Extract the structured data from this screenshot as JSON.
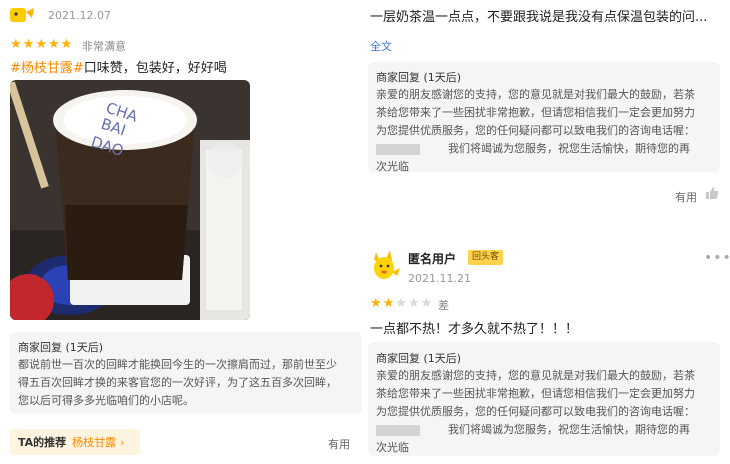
{
  "left": {
    "date": "2021.12.07",
    "rating": {
      "filled": 5,
      "total": 5,
      "label": "非常满意"
    },
    "review": {
      "tag1": "#杨枝甘露#",
      "text": "口味赞，包装好，好好喝"
    },
    "photo_cup_text": [
      "CHA",
      "BAI",
      "DAO"
    ],
    "merchant_reply": {
      "title": "商家回复 (1天后)",
      "lines": [
        "都说前世一百次的回眸才能换回今生的一次擦肩而过，那前世至少",
        "得五百次回眸才换的来客官您的一次好评，为了这五百多次回眸，",
        "您以后可得多多光临咱们的小店呢。"
      ]
    },
    "recommend": {
      "label": "TA的推荐",
      "item": "杨枝甘露"
    },
    "useful_label": "有用"
  },
  "right": {
    "top_text": "一层奶茶温一点点，不要跟我说是我没有点保温包装的问...",
    "fulltext_link": "全文",
    "merchant_reply1": {
      "title": "商家回复 (1天后)",
      "lines": [
        "亲爱的朋友感谢您的支持，您的意见就是对我们最大的鼓励，若茶",
        "茶给您带来了一些困扰非常抱歉，但请您相信我们一定会更加努力",
        "为您提供优质服务，您的任何疑问都可以致电我们的咨询电话喔：",
        "我们将竭诚为您服务，祝您生活愉快，期待您的再",
        "次光临"
      ]
    },
    "useful_label": "有用",
    "review2": {
      "username": "匿名用户",
      "badge": "回头客",
      "date": "2021.11.21",
      "rating": {
        "filled": 2,
        "total": 5,
        "label": "差"
      },
      "text": "一点都不热！才多久就不热了！！！"
    },
    "merchant_reply2": {
      "title": "商家回复 (1天后)",
      "lines": [
        "亲爱的朋友感谢您的支持，您的意见就是对我们最大的鼓励，若茶",
        "茶给您带来了一些困扰非常抱歉，但请您相信我们一定会更加努力",
        "为您提供优质服务，您的任何疑问都可以致电我们的咨询电话喔：",
        "我们将竭诚为您服务，祝您生活愉快，期待您的再",
        "次光临"
      ]
    }
  },
  "colors": {
    "accent": "#ff8a00",
    "star": "#ffb000",
    "link": "#3a78c9",
    "reply_bg": "#f5f5f5"
  }
}
